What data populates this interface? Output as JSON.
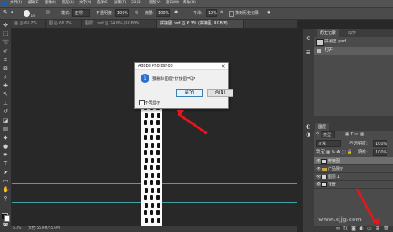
{
  "menubar": {
    "items": [
      "文件(F)",
      "编辑(E)",
      "图像(I)",
      "图层(L)",
      "文字(Y)",
      "选择(S)",
      "滤镜(T)",
      "3D(D)",
      "视图(V)",
      "窗口(W)",
      "帮助(H)"
    ]
  },
  "options": {
    "brush_size": "30",
    "mode_label": "模式:",
    "mode_value": "正常",
    "opacity_label": "不透明度:",
    "opacity_value": "100%",
    "flow_label": "流量:",
    "flow_value": "100%",
    "smooth_label": "平滑:",
    "smooth_value": "10%",
    "erase_history": "抹到历史记录"
  },
  "tabs": [
    {
      "label": "画 @ 66.7%(RGB/8)",
      "active": false
    },
    {
      "label": "图 @ 66.7%(RGB/8)",
      "active": false
    },
    {
      "label": "图层1.psd @ 24.8% (RGB/8) 50160729 @ ...",
      "active": false
    },
    {
      "label": "拼接图.psd @ 6.3% (拼接图, RGB/8)",
      "active": true
    }
  ],
  "dialog": {
    "title": "Adobe Photoshop",
    "close": "×",
    "message": "要删除图层\"拼接图\"吗?",
    "yes_label": "是(Y)",
    "no_label": "否(N)",
    "dont_show": "不再显示"
  },
  "panels": {
    "history_tab": "历史记录",
    "actions_tab": "动作",
    "doc_name": "拼接图.psd",
    "history_item": "打开",
    "layers_tab": "图层",
    "filter_kind": "类型",
    "blend_mode": "正常",
    "opacity_label": "不透明度:",
    "opacity_value": "100%",
    "lock_label": "锁定:",
    "fill_label": "填充:",
    "fill_value": "100%",
    "layers": [
      {
        "name": "拼接图",
        "selected": true
      },
      {
        "name": "产品展示",
        "selected": false
      },
      {
        "name": "图层 1",
        "selected": false
      },
      {
        "name": "背景",
        "selected": false
      }
    ]
  },
  "status": {
    "zoom": "6.3%",
    "doc_info": "文档:55.9M/55.9M"
  },
  "watermark": "www.xjjg.com",
  "colors": {
    "accent_blue": "#2d6fd2",
    "arrow_red": "#e8151a",
    "guide_teal": "#3fa3a8"
  }
}
